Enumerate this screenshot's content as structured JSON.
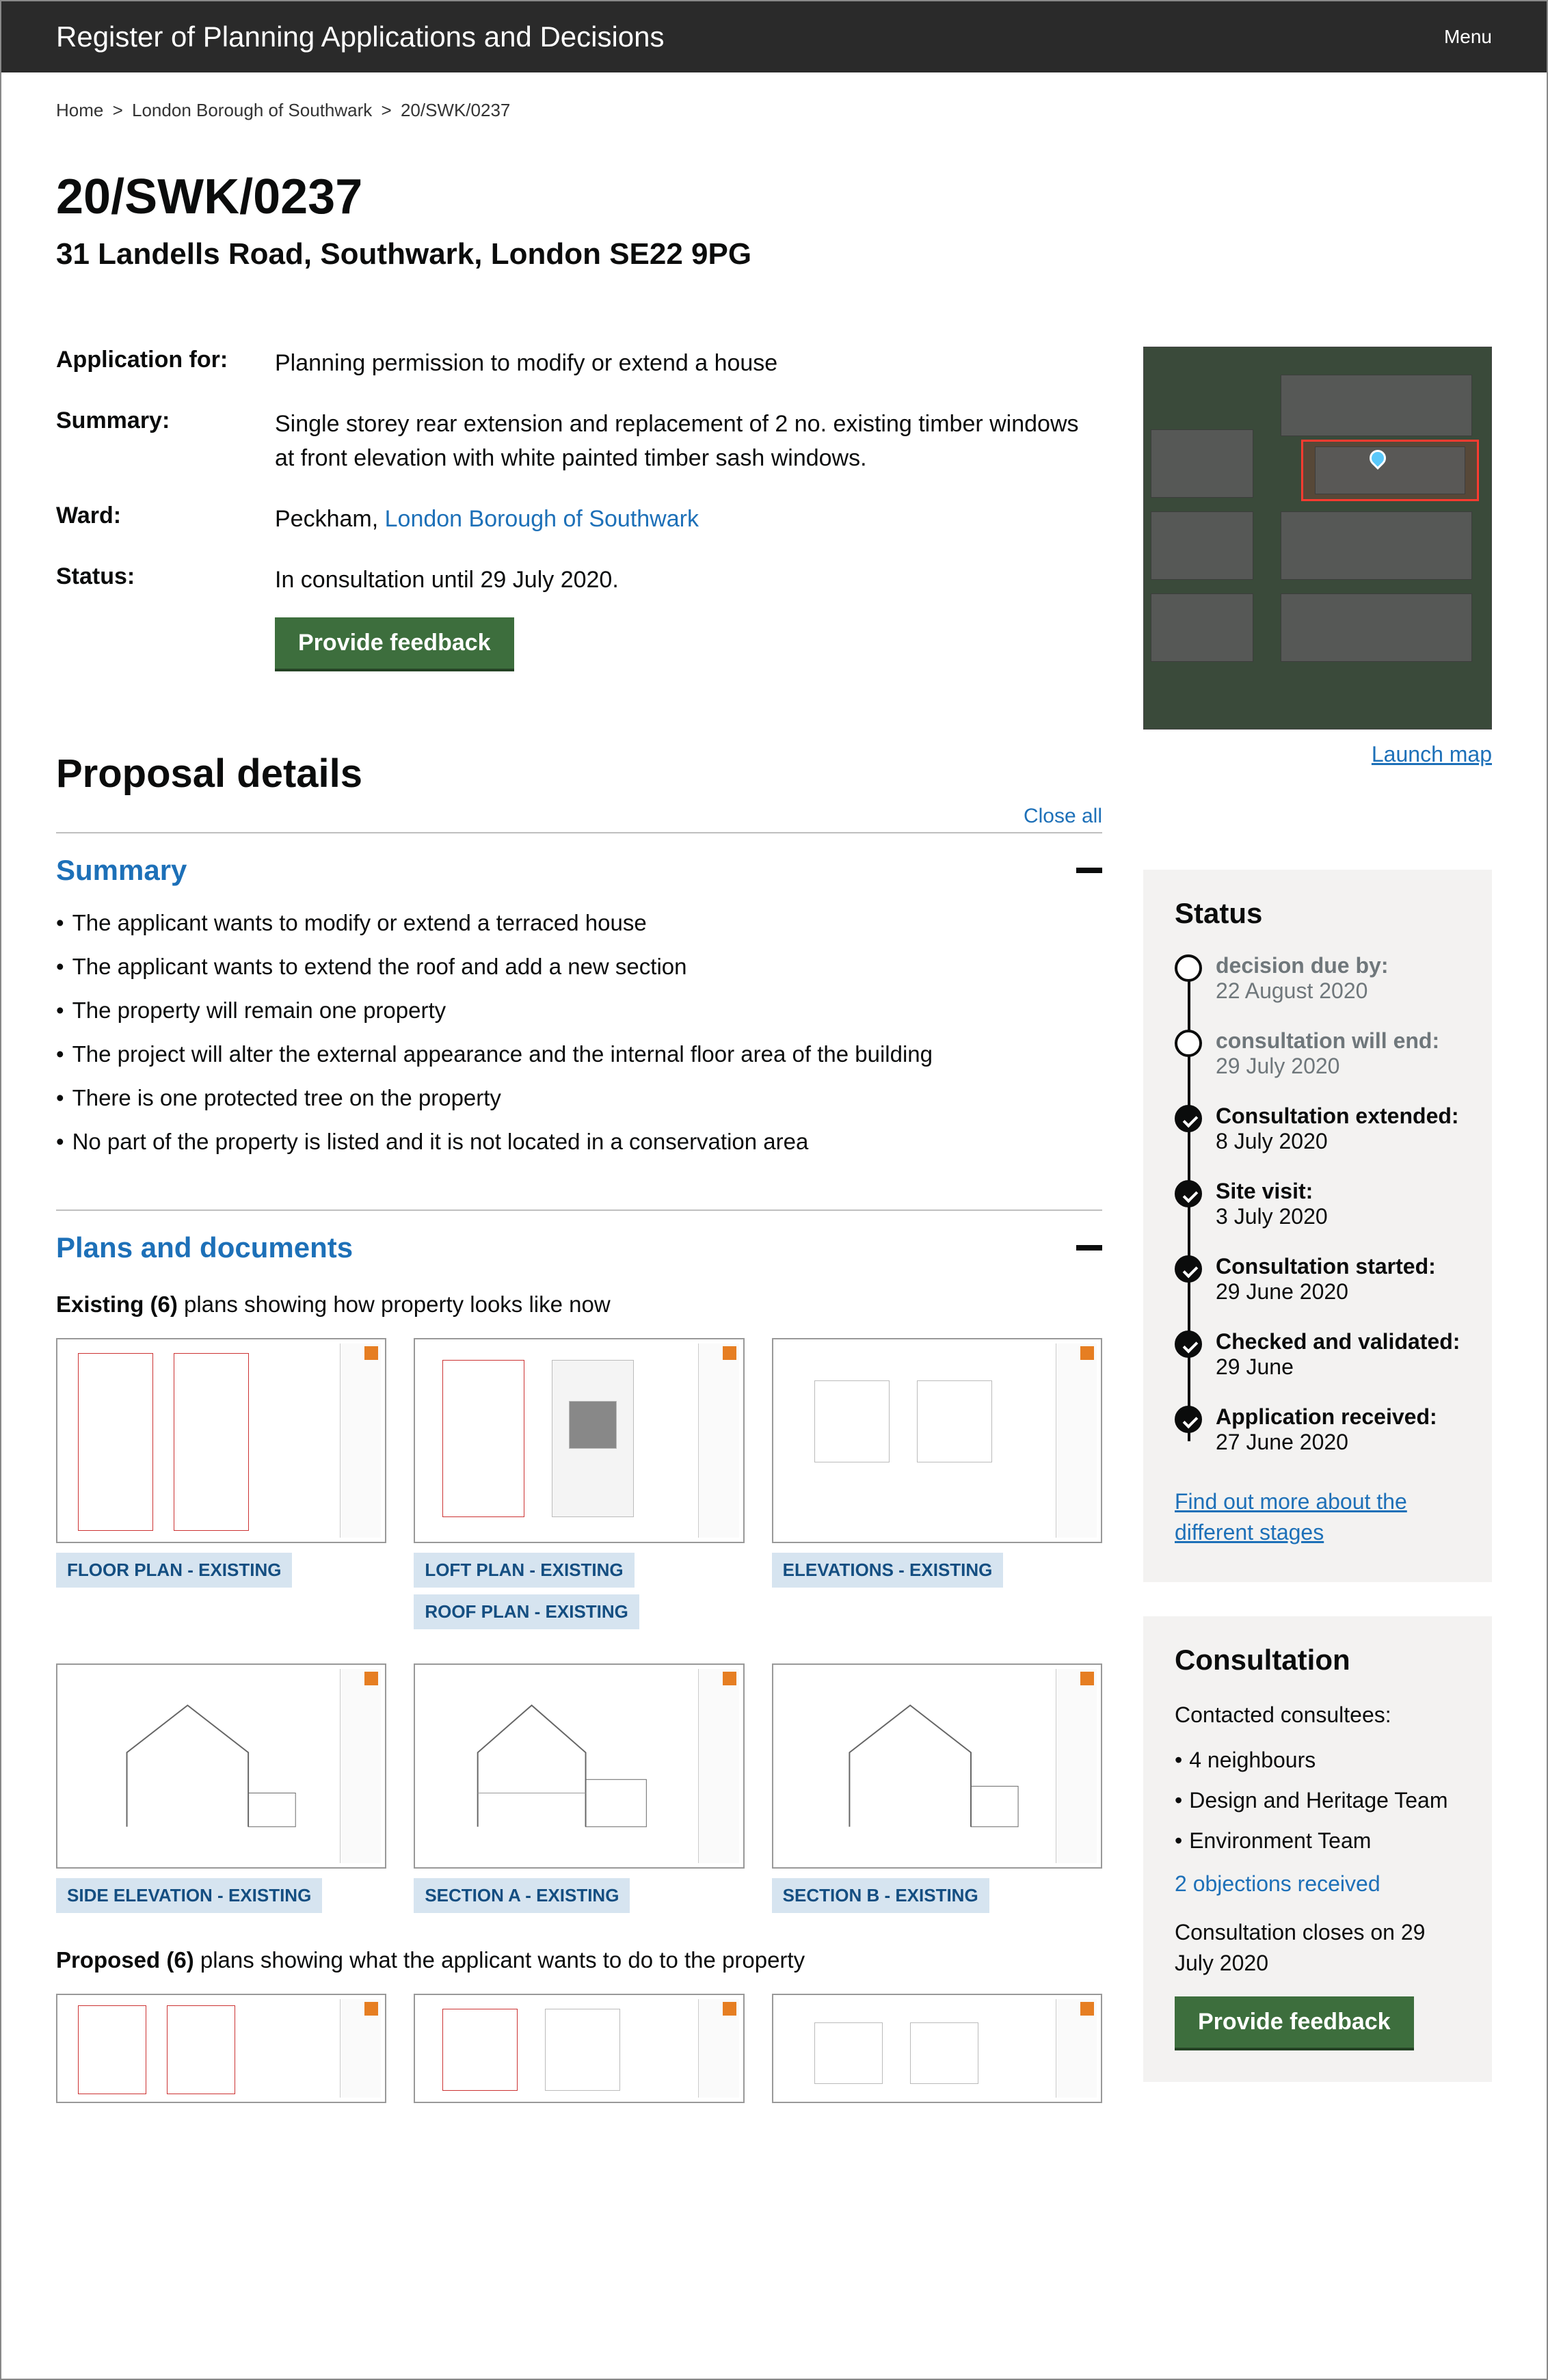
{
  "header": {
    "site_title": "Register of Planning Applications and Decisions",
    "menu": "Menu"
  },
  "breadcrumb": {
    "home": "Home",
    "borough": "London Borough of Southwark",
    "ref": "20/SWK/0237"
  },
  "title": {
    "reference": "20/SWK/0237",
    "address": "31 Landells Road, Southwark, London SE22 9PG"
  },
  "meta": {
    "application_for_label": "Application for:",
    "application_for_value": "Planning permission to modify or extend a house",
    "summary_label": "Summary:",
    "summary_value": "Single storey rear extension and replacement of 2 no. existing timber windows at front elevation with white painted timber sash windows.",
    "ward_label": "Ward:",
    "ward_value_prefix": "Peckham, ",
    "ward_link": "London Borough of Southwark",
    "status_label": "Status:",
    "status_value": "In consultation until 29 July 2020.",
    "feedback_button": "Provide feedback"
  },
  "map": {
    "launch": "Launch map"
  },
  "proposal": {
    "heading": "Proposal details",
    "close_all": "Close all",
    "summary_heading": "Summary",
    "summary_items": [
      "The applicant wants to modify or extend a terraced house",
      "The applicant wants to extend the roof and add a new section",
      "The property will remain one property",
      "The project will alter the external appearance and the internal floor area of the building",
      "There is one protected tree on the property",
      "No part of the property is listed and it is not located in a conservation area"
    ],
    "plans_heading": "Plans and documents",
    "existing_bold": "Existing (6)",
    "existing_rest": " plans showing how property looks like now",
    "proposed_bold": "Proposed (6)",
    "proposed_rest": " plans showing what the applicant wants to do to the property",
    "tags": {
      "r1c1": "FLOOR PLAN - EXISTING",
      "r1c2a": "LOFT PLAN - EXISTING",
      "r1c2b": "ROOF PLAN - EXISTING",
      "r1c3": "ELEVATIONS - EXISTING",
      "r2c1": "SIDE ELEVATION - EXISTING",
      "r2c2": "SECTION A - EXISTING",
      "r2c3": "SECTION B - EXISTING"
    }
  },
  "status_sidebar": {
    "heading": "Status",
    "items": [
      {
        "label": "decision due by:",
        "date": "22 August 2020",
        "done": false
      },
      {
        "label": "consultation will end:",
        "date": "29 July 2020",
        "done": false
      },
      {
        "label": "Consultation extended:",
        "date": "8 July 2020",
        "done": true
      },
      {
        "label": "Site visit:",
        "date": "3 July 2020",
        "done": true
      },
      {
        "label": "Consultation started:",
        "date": "29 June 2020",
        "done": true
      },
      {
        "label": "Checked and validated:",
        "date": "29 June",
        "done": true
      },
      {
        "label": "Application received:",
        "date": "27 June 2020",
        "done": true
      }
    ],
    "more_link": "Find out more about the different stages"
  },
  "consultation": {
    "heading": "Consultation",
    "intro": "Contacted consultees:",
    "items": [
      "4 neighbours",
      "Design and Heritage Team",
      "Environment Team"
    ],
    "objections_link": "2 objections received",
    "closes": "Consultation closes on 29 July 2020",
    "button": "Provide feedback"
  }
}
